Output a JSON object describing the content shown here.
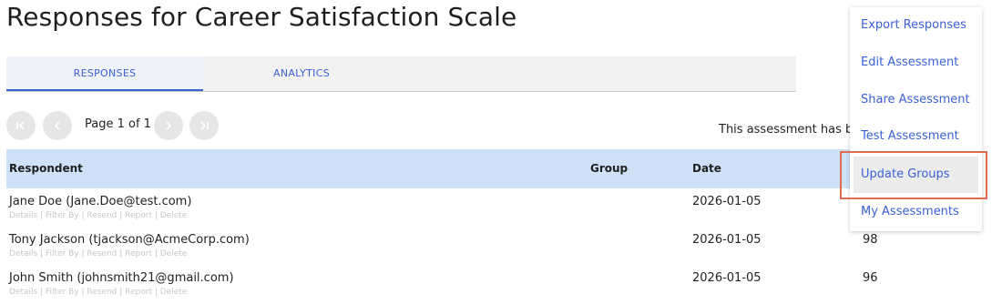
{
  "page": {
    "title": "Responses for Career Satisfaction Scale"
  },
  "tabs": [
    {
      "label": "RESPONSES",
      "active": true
    },
    {
      "label": "ANALYTICS",
      "active": false
    }
  ],
  "pager": {
    "label": "Page 1 of 1"
  },
  "notice": "This assessment has be",
  "table": {
    "headers": {
      "respondent": "Respondent",
      "group": "Group",
      "date": "Date"
    },
    "action_links": "Details | Filter By | Resend | Report | Delete",
    "rows": [
      {
        "respondent": "Jane Doe (Jane.Doe@test.com)",
        "group": "",
        "date": "2026-01-05",
        "score": ""
      },
      {
        "respondent": "Tony Jackson (tjackson@AcmeCorp.com)",
        "group": "",
        "date": "2026-01-05",
        "score": "98"
      },
      {
        "respondent": "John Smith (johnsmith21@gmail.com)",
        "group": "",
        "date": "2026-01-05",
        "score": "96"
      }
    ]
  },
  "menu": {
    "items": [
      {
        "label": "Export Responses"
      },
      {
        "label": "Edit Assessment"
      },
      {
        "label": "Share Assessment"
      },
      {
        "label": "Test Assessment"
      },
      {
        "label": "Update Groups",
        "highlighted": true
      },
      {
        "label": "My Assessments"
      }
    ]
  },
  "colors": {
    "accent": "#3c5fd6",
    "header_bg": "#cfe1f7",
    "highlight_border": "#e06a50"
  },
  "icons": [
    "first-page-icon",
    "prev-page-icon",
    "next-page-icon",
    "last-page-icon"
  ]
}
